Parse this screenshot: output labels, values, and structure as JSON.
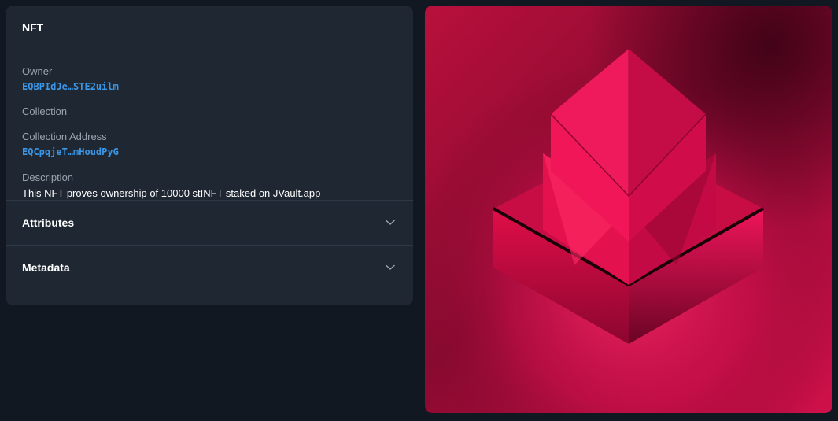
{
  "card": {
    "title": "NFT",
    "owner_label": "Owner",
    "owner_value": "EQBPIdJe…STE2uilm",
    "collection_label": "Collection",
    "collection_address_label": "Collection Address",
    "collection_address_value": "EQCpqjeT…mHoudPyG",
    "description_label": "Description",
    "description_value": "This NFT proves ownership of 10000 stINFT staked on JVault.app",
    "accordions": [
      {
        "label": "Attributes",
        "icon": "chevron-down-icon"
      },
      {
        "label": "Metadata",
        "icon": "chevron-down-icon"
      }
    ]
  },
  "colors": {
    "background": "#121821",
    "card": "#1f2733",
    "link": "#3b97e8",
    "image_accent": "#ff0a55"
  }
}
